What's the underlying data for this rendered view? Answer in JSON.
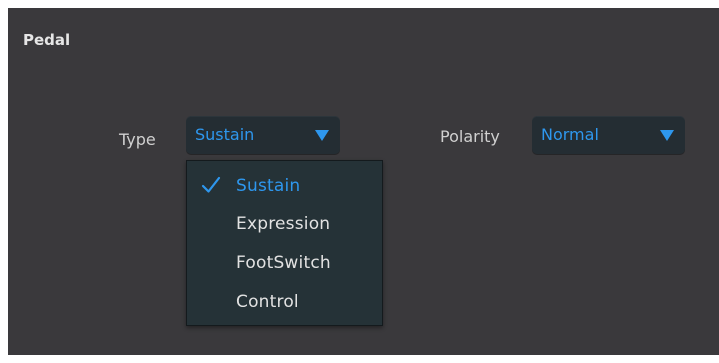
{
  "section": {
    "title": "Pedal"
  },
  "type_field": {
    "label": "Type",
    "value": "Sustain",
    "options": [
      {
        "label": "Sustain",
        "selected": true
      },
      {
        "label": "Expression",
        "selected": false
      },
      {
        "label": "FootSwitch",
        "selected": false
      },
      {
        "label": "Control",
        "selected": false
      }
    ]
  },
  "polarity_field": {
    "label": "Polarity",
    "value": "Normal"
  },
  "icons": {
    "dropdown_caret": "caret-down-icon",
    "selected_mark": "checkmark-icon"
  },
  "colors": {
    "panel_background": "#3a393c",
    "accent": "#2e97ee",
    "select_background": "#242d33",
    "menu_background": "#253237",
    "text": "#e2e2e2"
  }
}
